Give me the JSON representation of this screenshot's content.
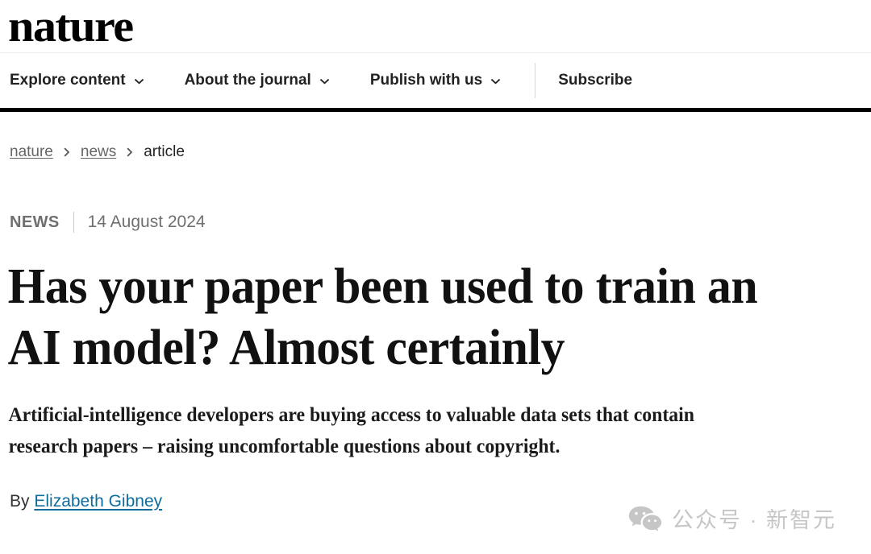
{
  "masthead": {
    "logo_text": "nature",
    "logo_icon": "nature-wordmark"
  },
  "nav": {
    "items": [
      {
        "label": "Explore content",
        "has_dropdown": true,
        "icon": "chevron-down-icon"
      },
      {
        "label": "About the journal",
        "has_dropdown": true,
        "icon": "chevron-down-icon"
      },
      {
        "label": "Publish with us",
        "has_dropdown": true,
        "icon": "chevron-down-icon"
      },
      {
        "label": "Subscribe",
        "has_dropdown": false,
        "icon": ""
      }
    ]
  },
  "breadcrumb": {
    "items": [
      {
        "label": "nature",
        "is_link": true
      },
      {
        "label": "news",
        "is_link": true
      },
      {
        "label": "article",
        "is_link": false
      }
    ],
    "separator_icon": "chevron-right-icon"
  },
  "article": {
    "kicker": "NEWS",
    "date": "14 August 2024",
    "headline_line1": "Has your paper been used to train an",
    "headline_line2": "AI model? Almost certainly",
    "standfirst_line1": "Artificial-intelligence developers are buying access to valuable data sets that contain",
    "standfirst_line2": "research papers – raising uncomfortable questions about copyright.",
    "byline_prefix": "By",
    "byline_author": "Elizabeth Gibney"
  },
  "watermark": {
    "icon": "wechat-icon",
    "text": "公众号 · 新智元"
  },
  "colors": {
    "link_blue": "#0f6d9e",
    "rule_black": "#000000",
    "muted_grey": "#6f6f6f",
    "watermark_grey": "#c6c6c6"
  }
}
